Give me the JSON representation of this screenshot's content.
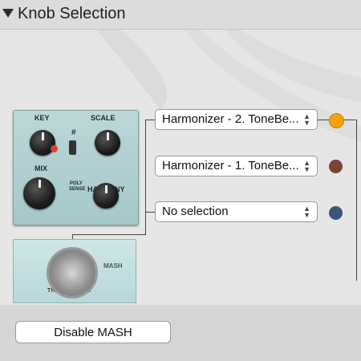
{
  "header": {
    "title": "Knob Selection"
  },
  "pedal": {
    "labels": {
      "key": "KEY",
      "scale": "SCALE",
      "mix": "MIX",
      "harmony": "HARMONY",
      "sharp": "#",
      "poly": "POLY",
      "sense": "SENSE"
    },
    "mash_text": "MASH",
    "bypass_text": "TRUE BYPASS"
  },
  "selects": [
    {
      "value": "Harmonizer - 2. ToneBe...",
      "dot_color": "#f4a300"
    },
    {
      "value": "Harmonizer - 1. ToneBe...",
      "dot_color": "#7a4236"
    },
    {
      "value": "No selection",
      "dot_color": "#3b5579"
    }
  ],
  "footer": {
    "button_label": "Disable MASH"
  }
}
